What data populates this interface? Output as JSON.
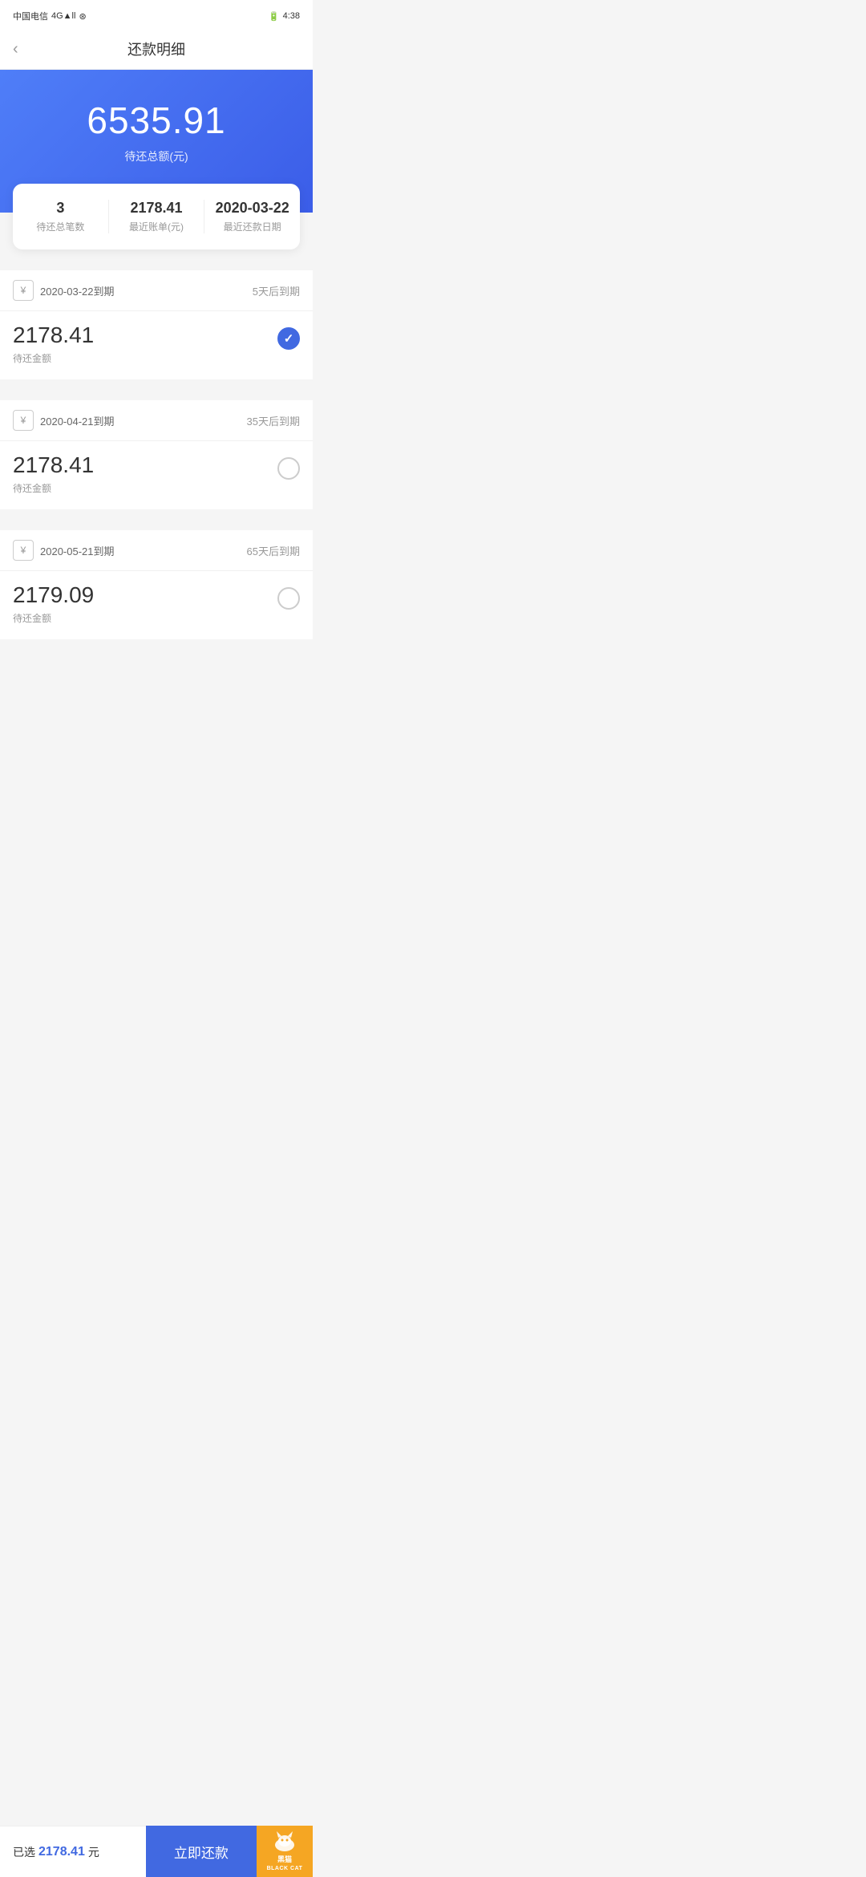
{
  "statusBar": {
    "carrier": "中国电信",
    "signal": "4G",
    "time": "4:38"
  },
  "navBar": {
    "backLabel": "‹",
    "title": "还款明细"
  },
  "hero": {
    "amount": "6535.91",
    "label": "待还总额(元)"
  },
  "summary": {
    "items": [
      {
        "value": "3",
        "desc": "待还总笔数"
      },
      {
        "value": "2178.41",
        "desc": "最近账单(元)"
      },
      {
        "value": "2020-03-22",
        "desc": "最近还款日期"
      }
    ]
  },
  "payments": [
    {
      "dueDate": "2020-03-22到期",
      "dueTag": "5天后到期",
      "amount": "2178.41",
      "amountLabel": "待还金额",
      "checked": true
    },
    {
      "dueDate": "2020-04-21到期",
      "dueTag": "35天后到期",
      "amount": "2178.41",
      "amountLabel": "待还金额",
      "checked": false
    },
    {
      "dueDate": "2020-05-21到期",
      "dueTag": "65天后到期",
      "amount": "2179.09",
      "amountLabel": "待还金额",
      "checked": false
    }
  ],
  "bottomBar": {
    "selectedPrefix": "已选",
    "selectedAmount": "2178.41",
    "selectedSuffix": "元",
    "payButtonLabel": "立即还款",
    "blackCatLine1": "黑猫",
    "blackCatLine2": "BLACK CAT"
  }
}
